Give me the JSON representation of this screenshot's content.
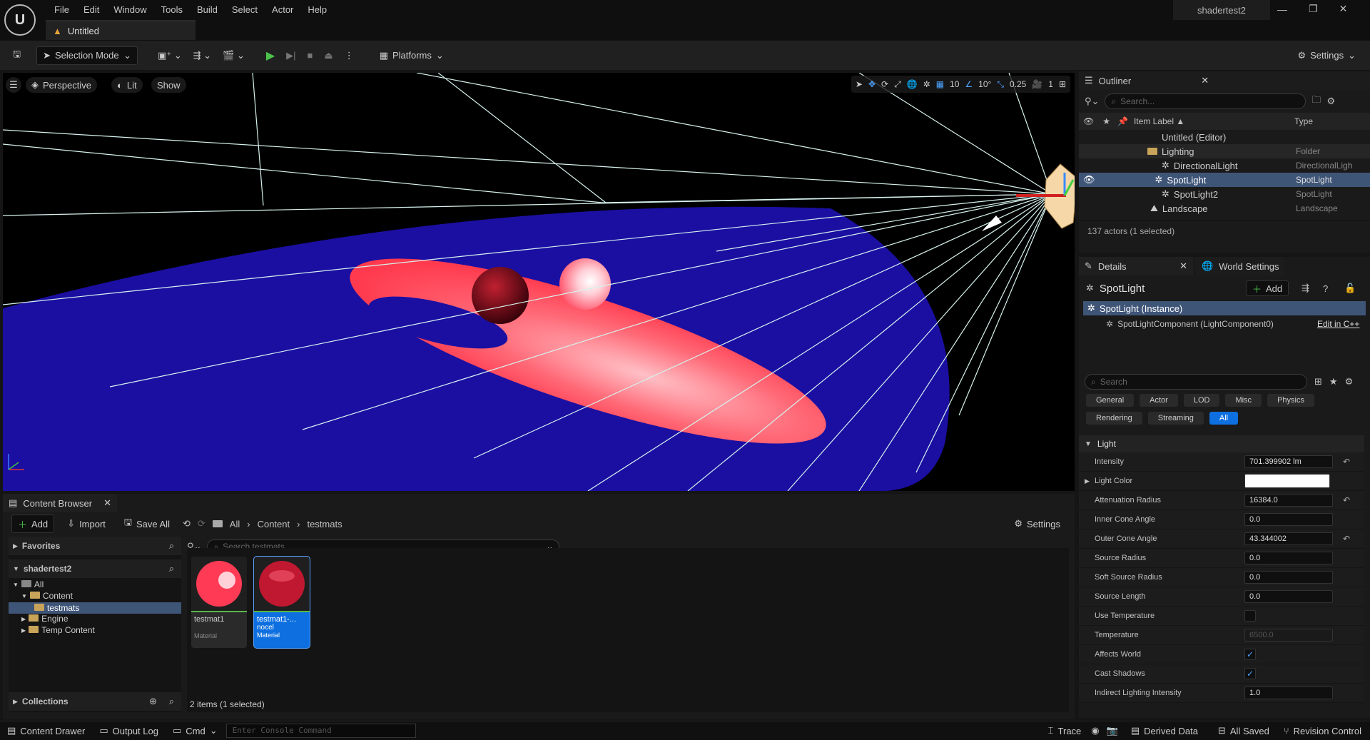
{
  "app": {
    "project_name": "shadertest2",
    "doc_tab": "Untitled"
  },
  "menu": [
    "File",
    "Edit",
    "Window",
    "Tools",
    "Build",
    "Select",
    "Actor",
    "Help"
  ],
  "toolbar": {
    "selection_mode": "Selection Mode",
    "platforms": "Platforms",
    "settings": "Settings"
  },
  "viewport": {
    "perspective": "Perspective",
    "lit": "Lit",
    "show": "Show",
    "grid_snap": "10",
    "rot_snap": "10°",
    "scale_snap": "0.25",
    "camera_speed": "1",
    "colors": {
      "floor": "#1a0f9e",
      "spot": "#ff4a5a",
      "spot_center": "#ffb0b6"
    }
  },
  "outliner": {
    "tab": "Outliner",
    "search_placeholder": "Search...",
    "col_label": "Item Label ▲",
    "col_type": "Type",
    "rows": [
      {
        "label": "Untitled (Editor)",
        "type": ""
      },
      {
        "label": "Lighting",
        "type": "Folder"
      },
      {
        "label": "DirectionalLight",
        "type": "DirectionalLigh"
      },
      {
        "label": "SpotLight",
        "type": "SpotLight"
      },
      {
        "label": "SpotLight2",
        "type": "SpotLight"
      },
      {
        "label": "Landscape",
        "type": "Landscape"
      }
    ],
    "status": "137 actors (1 selected)"
  },
  "details": {
    "tab": "Details",
    "world_tab": "World Settings",
    "actor": "SpotLight",
    "add": "Add",
    "instance": "SpotLight (Instance)",
    "component": "SpotLightComponent (LightComponent0)",
    "edit_cpp": "Edit in C++",
    "search_placeholder": "Search",
    "filters_row1": [
      "General",
      "Actor",
      "LOD",
      "Misc",
      "Physics"
    ],
    "filters_row2": [
      "Rendering",
      "Streaming",
      "All"
    ],
    "section": "Light",
    "props": [
      {
        "label": "Intensity",
        "value": "701.399902 lm"
      },
      {
        "label": "Light Color",
        "value": ""
      },
      {
        "label": "Attenuation Radius",
        "value": "16384.0"
      },
      {
        "label": "Inner Cone Angle",
        "value": "0.0"
      },
      {
        "label": "Outer Cone Angle",
        "value": "43.344002"
      },
      {
        "label": "Source Radius",
        "value": "0.0"
      },
      {
        "label": "Soft Source Radius",
        "value": "0.0"
      },
      {
        "label": "Source Length",
        "value": "0.0"
      },
      {
        "label": "Use Temperature",
        "value": ""
      },
      {
        "label": "Temperature",
        "value": "6500.0"
      },
      {
        "label": "Affects World",
        "value": "✓"
      },
      {
        "label": "Cast Shadows",
        "value": "✓"
      },
      {
        "label": "Indirect Lighting Intensity",
        "value": "1.0"
      }
    ]
  },
  "content_browser": {
    "tab": "Content Browser",
    "add": "Add",
    "import": "Import",
    "save_all": "Save All",
    "path": [
      "All",
      "Content",
      "testmats"
    ],
    "settings": "Settings",
    "favorites": "Favorites",
    "project": "shadertest2",
    "collections": "Collections",
    "tree": [
      "All",
      "Content",
      "testmats",
      "Engine",
      "Temp Content"
    ],
    "search_placeholder": "Search testmats",
    "assets": [
      {
        "name": "testmat1",
        "type": "Material"
      },
      {
        "name": "testmat1-...",
        "sub": "nocel",
        "type": "Material"
      }
    ],
    "count": "2 items (1 selected)"
  },
  "statusbar": {
    "content_drawer": "Content Drawer",
    "output_log": "Output Log",
    "cmd": "Cmd",
    "console_placeholder": "Enter Console Command",
    "trace": "Trace",
    "derived": "Derived Data",
    "saved": "All Saved",
    "revision": "Revision Control"
  }
}
